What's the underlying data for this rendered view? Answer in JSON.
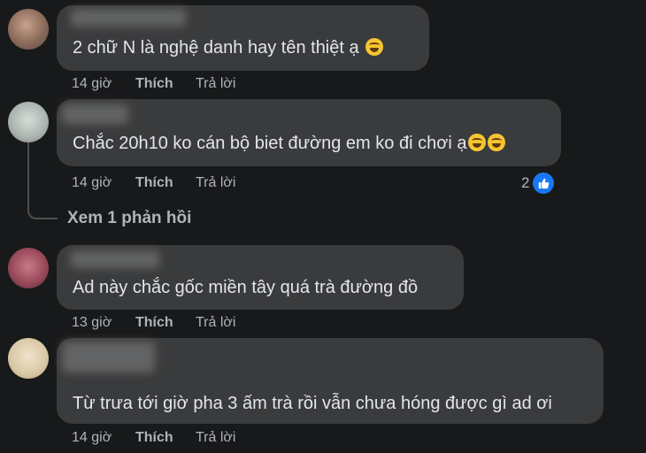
{
  "comments": [
    {
      "text": "2 chữ N là nghệ danh hay tên thiệt ạ",
      "emoji": "grinning-face-with-sweat",
      "time": "14 giờ",
      "like_label": "Thích",
      "reply_label": "Trả lời"
    },
    {
      "text": "Chắc 20h10 ko cán bộ biet đường em ko đi chơi ạ",
      "emoji": "rolling-on-floor-laughing",
      "time": "14 giờ",
      "like_label": "Thích",
      "reply_label": "Trả lời",
      "reaction_count": "2",
      "reaction_icon": "like-icon",
      "view_replies_label": "Xem 1 phản hồi"
    },
    {
      "text": "Ad này chắc gốc miền tây quá trà đường đồ",
      "time": "13 giờ",
      "like_label": "Thích",
      "reply_label": "Trả lời"
    },
    {
      "text": "Từ trưa tới giờ pha 3 ấm trà rồi vẫn chưa hóng được gì ad ơi",
      "time": "14 giờ",
      "like_label": "Thích",
      "reply_label": "Trả lời"
    }
  ],
  "colors": {
    "background": "#18191a",
    "bubble": "#3a3b3c",
    "text": "#e4e6eb",
    "meta": "#b0b3b8",
    "like_badge": "#1877f2"
  }
}
